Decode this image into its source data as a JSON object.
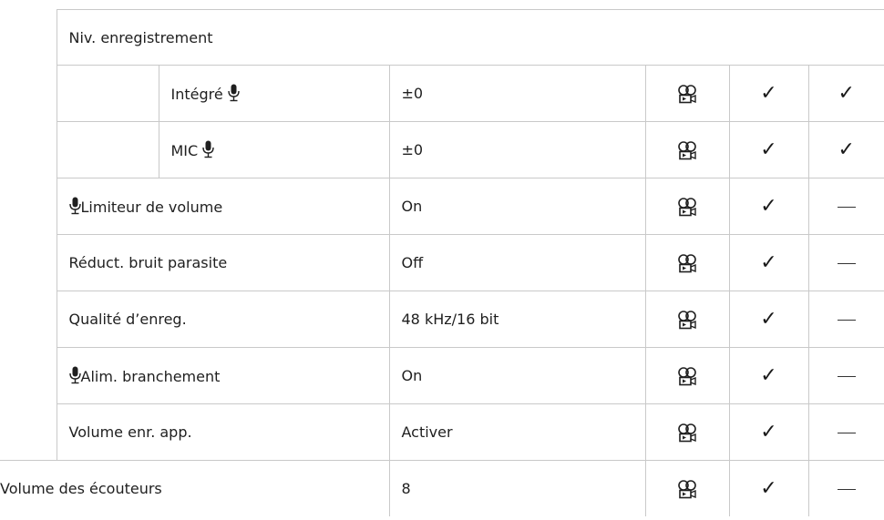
{
  "group_header": "Niv. enregistrement",
  "rows": [
    {
      "label": "Intégré",
      "mic_after": true,
      "mic_before": false,
      "value": "±0",
      "mode_icon": "movie-icon",
      "col2": "check",
      "col3": "check"
    },
    {
      "label": "MIC",
      "mic_after": true,
      "mic_before": false,
      "value": "±0",
      "mode_icon": "movie-icon",
      "col2": "check",
      "col3": "check"
    },
    {
      "label": "Limiteur de volume",
      "mic_before": true,
      "value": "On",
      "mode_icon": "movie-icon",
      "col2": "check",
      "col3": "dash"
    },
    {
      "label": "Réduct. bruit parasite",
      "mic_before": false,
      "value": "Off",
      "mode_icon": "movie-icon",
      "col2": "check",
      "col3": "dash"
    },
    {
      "label": "Qualité d’enreg.",
      "mic_before": false,
      "value": "48 kHz/16 bit",
      "mode_icon": "movie-icon",
      "col2": "check",
      "col3": "dash"
    },
    {
      "label": "Alim. branchement",
      "mic_before": true,
      "value": "On",
      "mode_icon": "movie-icon",
      "col2": "check",
      "col3": "dash"
    },
    {
      "label": "Volume enr. app.",
      "mic_before": false,
      "value": "Activer",
      "mode_icon": "movie-icon",
      "col2": "check",
      "col3": "dash"
    },
    {
      "label": "Volume des écouteurs",
      "mic_before": false,
      "value": "8",
      "mode_icon": "movie-icon",
      "col2": "check",
      "col3": "dash"
    }
  ],
  "symbols": {
    "check": "✓",
    "dash": "—"
  },
  "colors": {
    "border": "#c9c9c9",
    "text": "#1f1f1f"
  }
}
